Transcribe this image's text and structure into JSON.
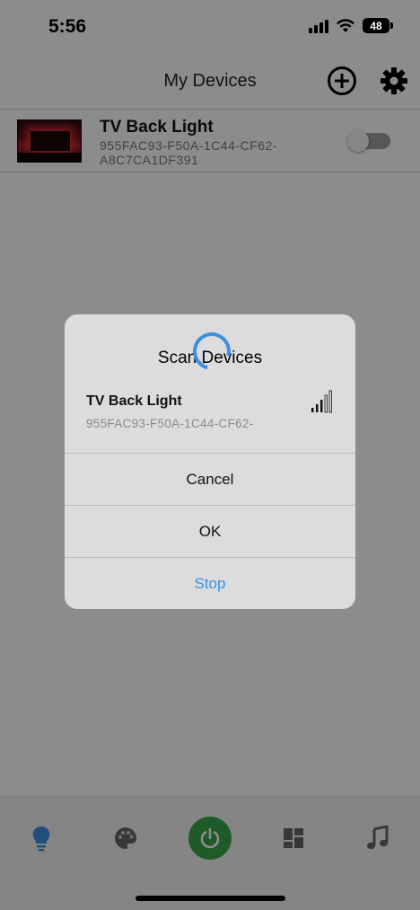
{
  "status_bar": {
    "time": "5:56",
    "battery": "48",
    "battery_level_percent": 48
  },
  "header": {
    "title": "My Devices",
    "add_icon": "add-circle-icon",
    "settings_icon": "gear-icon"
  },
  "device": {
    "name": "TV Back Light",
    "id": "955FAC93-F50A-1C44-CF62-A8C7CA1DF391",
    "power_on": false
  },
  "dialog": {
    "title": "Scan Devices",
    "found_device": {
      "name": "TV Back Light",
      "id": "955FAC93-F50A-1C44-CF62-"
    },
    "buttons": {
      "cancel": "Cancel",
      "ok": "OK",
      "stop": "Stop"
    }
  },
  "tab_bar": {
    "tabs": [
      {
        "icon": "bulb-icon",
        "selected": true
      },
      {
        "icon": "palette-icon",
        "selected": false
      },
      {
        "icon": "power-icon",
        "selected": false
      },
      {
        "icon": "dashboard-icon",
        "selected": false
      },
      {
        "icon": "music-note-icon",
        "selected": false
      }
    ]
  },
  "colors": {
    "accent_blue": "#3e8fe0",
    "power_green": "#3aa64a",
    "overlay": "rgba(0,0,0,0.45)"
  }
}
